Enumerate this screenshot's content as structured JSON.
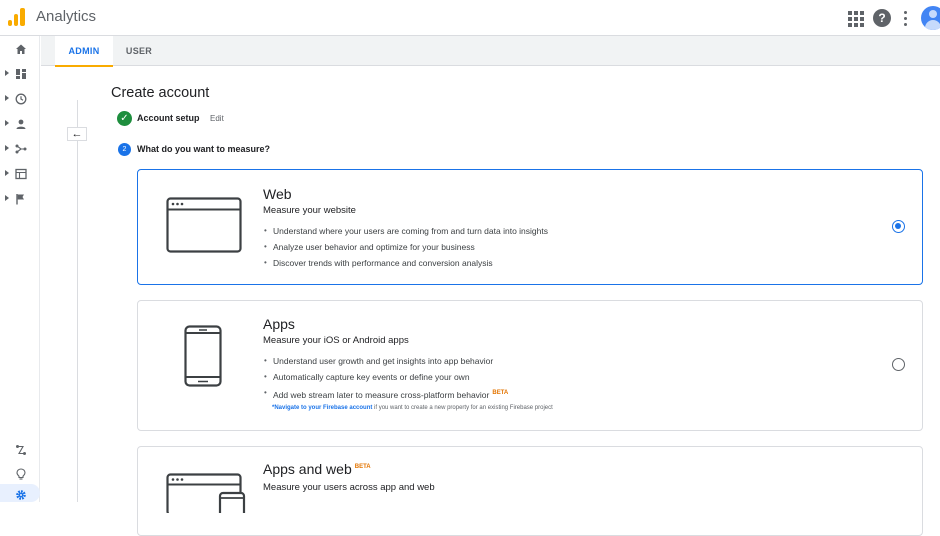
{
  "header": {
    "title": "Analytics",
    "icons": [
      "apps-grid-icon",
      "help-icon",
      "more-vert-icon",
      "account-avatar"
    ]
  },
  "rail": {
    "items": [
      "home-icon",
      "dashboard-icon",
      "realtime-clock-icon",
      "audience-icon",
      "acquisition-icon",
      "behavior-icon",
      "conversions-flag-icon"
    ],
    "bottom": [
      "attribution-icon",
      "insights-bulb-icon",
      "admin-gear-icon"
    ]
  },
  "tabs": [
    {
      "label": "ADMIN",
      "active": true
    },
    {
      "label": "USER",
      "active": false
    }
  ],
  "page": {
    "title": "Create account",
    "back_label": "←",
    "step1": {
      "label": "Account setup",
      "edit": "Edit",
      "check": "✓"
    },
    "step2": {
      "number": "2",
      "label": "What do you want to measure?"
    }
  },
  "cards": [
    {
      "title": "Web",
      "subtitle": "Measure your website",
      "bullets": [
        "Understand where your users are coming from and turn data into insights",
        "Analyze user behavior and optimize for your business",
        "Discover trends with performance and conversion analysis"
      ],
      "selected": true
    },
    {
      "title": "Apps",
      "subtitle": "Measure your iOS or Android apps",
      "bullets": [
        "Understand user growth and get insights into app behavior",
        "Automatically capture key events or define your own",
        "Add web stream later to measure cross-platform behavior"
      ],
      "bullet_badge": "BETA",
      "note_link": "*Navigate to your Firebase account",
      "note_text": " if you want to create a new property for an existing Firebase project",
      "selected": false
    },
    {
      "title": "Apps and web",
      "title_badge": "BETA",
      "subtitle": "Measure your users across app and web"
    }
  ],
  "colors": {
    "accent": "#1a73e8",
    "brand": "#f9ab00",
    "success": "#1e8e3e",
    "beta": "#e37400"
  }
}
